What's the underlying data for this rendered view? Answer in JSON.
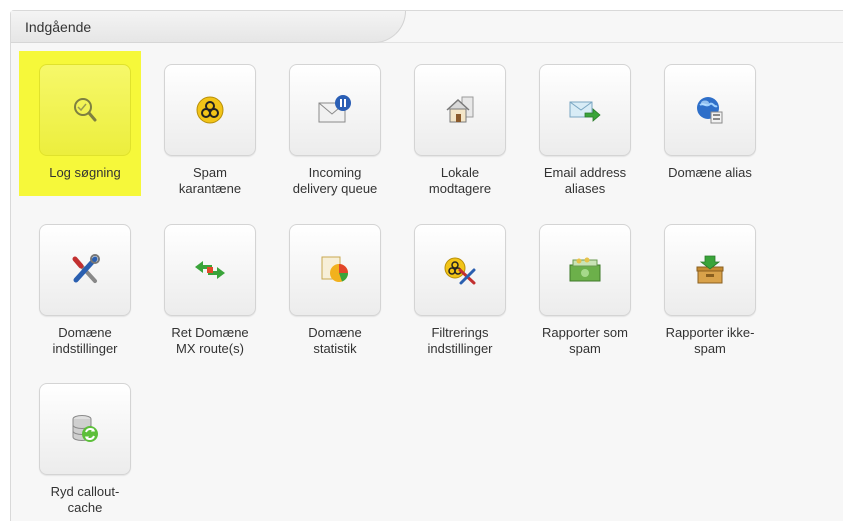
{
  "header": {
    "title": "Indgående"
  },
  "items": [
    {
      "name": "log-search",
      "icon": "magnifier-icon",
      "lines": [
        "Log søgning"
      ],
      "highlighted": true,
      "highlight_color": "#f6f83a"
    },
    {
      "name": "spam-quarantine",
      "icon": "biohazard-icon",
      "lines": [
        "Spam",
        "karantæne"
      ]
    },
    {
      "name": "incoming-delivery-queue",
      "icon": "envelope-pause-icon",
      "lines": [
        "Incoming",
        "delivery queue"
      ]
    },
    {
      "name": "local-recipients",
      "icon": "house-icon",
      "lines": [
        "Lokale",
        "modtagere"
      ]
    },
    {
      "name": "email-address-aliases",
      "icon": "mail-forward-icon",
      "lines": [
        "Email address",
        "aliases"
      ]
    },
    {
      "name": "domain-alias",
      "icon": "globe-icon",
      "lines": [
        "Domæne alias"
      ]
    },
    {
      "name": "domain-settings",
      "icon": "tools-icon",
      "lines": [
        "Domæne",
        "indstillinger"
      ]
    },
    {
      "name": "edit-domain-mx-routes",
      "icon": "route-arrows-icon",
      "lines": [
        "Ret Domæne",
        "MX route(s)"
      ]
    },
    {
      "name": "domain-statistics",
      "icon": "pie-chart-icon",
      "lines": [
        "Domæne",
        "statistik"
      ]
    },
    {
      "name": "filter-settings",
      "icon": "biohazard-tools-icon",
      "lines": [
        "Filtrerings",
        "indstillinger"
      ]
    },
    {
      "name": "report-as-spam",
      "icon": "cash-icon",
      "lines": [
        "Rapporter som",
        "spam"
      ]
    },
    {
      "name": "report-not-spam",
      "icon": "archive-box-icon",
      "lines": [
        "Rapporter ikke-",
        "spam"
      ]
    },
    {
      "name": "clear-callout-cache",
      "icon": "database-refresh-icon",
      "lines": [
        "Ryd callout-",
        "cache"
      ]
    }
  ]
}
